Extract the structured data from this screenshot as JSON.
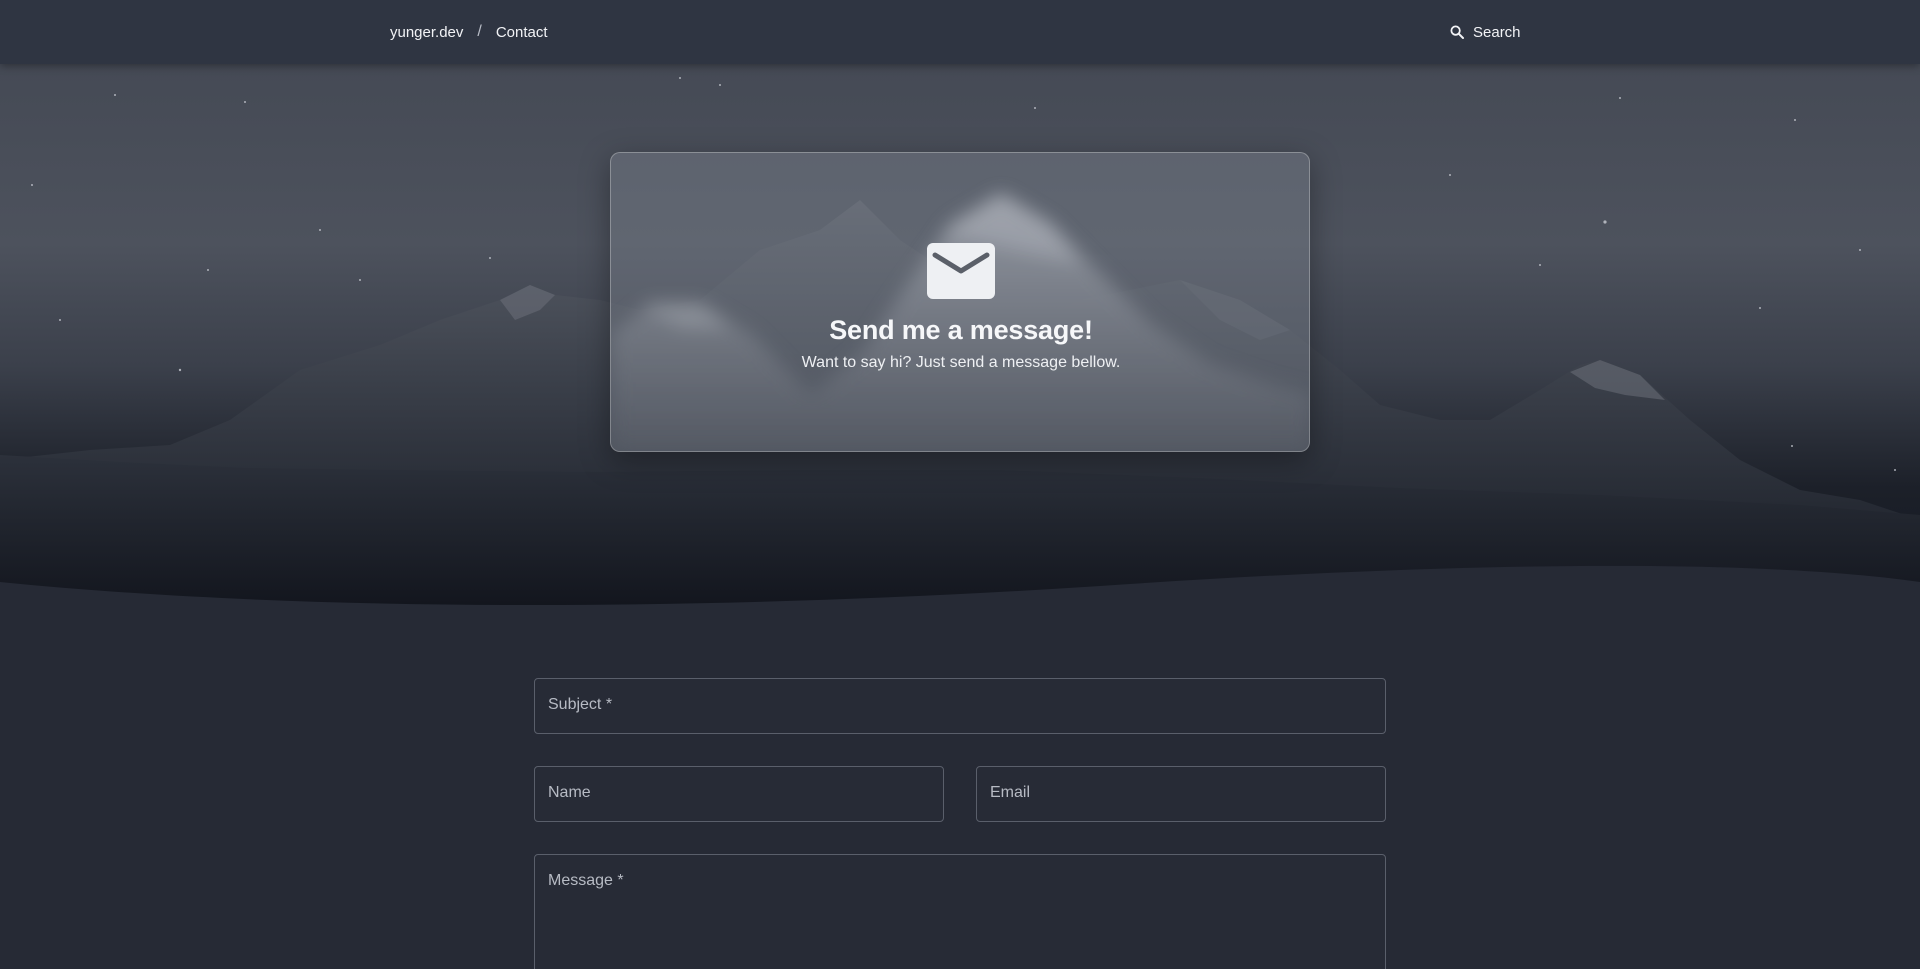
{
  "header": {
    "site_name": "yunger.dev",
    "separator": "/",
    "current_page": "Contact",
    "search_label": "Search"
  },
  "hero": {
    "title": "Send me a message!",
    "subtitle": "Want to say hi? Just send a message bellow."
  },
  "form": {
    "subject_label": "Subject *",
    "name_label": "Name",
    "email_label": "Email",
    "message_label": "Message *",
    "subject_value": "",
    "name_value": "",
    "email_value": "",
    "message_value": ""
  },
  "icons": {
    "search": "search-icon",
    "envelope": "envelope-icon"
  },
  "colors": {
    "topbar": "#2f3542",
    "page_background": "#262a35",
    "field_border": "#5a5f6b",
    "text": "#f2f3f6",
    "label": "#b7bbc4"
  }
}
